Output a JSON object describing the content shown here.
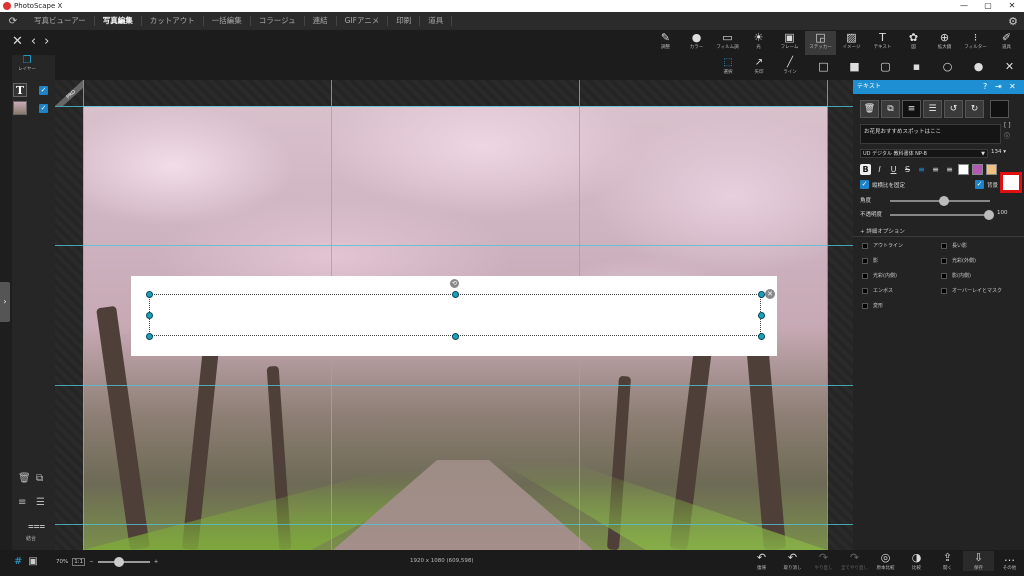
{
  "window": {
    "title": "PhotoScape X",
    "controls": [
      "—",
      "▢",
      "✕"
    ]
  },
  "menu": {
    "items": [
      "写真ビューアー",
      "写真編集",
      "カットアウト",
      "一括編集",
      "コラージュ",
      "連結",
      "GIFアニメ",
      "印刷",
      "道具"
    ],
    "active": "写真編集"
  },
  "nav": {
    "close": "✕",
    "back": "‹",
    "forward": "›"
  },
  "edit_tools": [
    {
      "icon": "✎",
      "label": "調整"
    },
    {
      "icon": "●",
      "label": "カラー"
    },
    {
      "icon": "▭",
      "label": "フィルム調"
    },
    {
      "icon": "☀",
      "label": "光"
    },
    {
      "icon": "▣",
      "label": "フレーム"
    },
    {
      "icon": "◲",
      "label": "ステッカー"
    },
    {
      "icon": "▨",
      "label": "イメージ"
    },
    {
      "icon": "T",
      "label": "テキスト"
    },
    {
      "icon": "✿",
      "label": "図"
    },
    {
      "icon": "⊕",
      "label": "拡大鏡"
    },
    {
      "icon": "⁝",
      "label": "フィルター"
    },
    {
      "icon": "✐",
      "label": "道具"
    }
  ],
  "insert_tools": [
    {
      "icon": "⬚",
      "label": "選択"
    },
    {
      "icon": "↗",
      "label": "矢印"
    },
    {
      "icon": "╱",
      "label": "ライン"
    }
  ],
  "shape_tools": [
    "□",
    "■",
    "▢",
    "▪",
    "○",
    "●",
    "✕"
  ],
  "layers": {
    "label": "レイヤー",
    "combine_label": "結合",
    "badge": "PRO"
  },
  "text_panel": {
    "title": "テキスト",
    "text_value": "お花見おすすめスポットはここ",
    "font": "UD デジタル 教科書体 NP-B",
    "font_size": "134",
    "keep_ratio": "縦横比を固定",
    "bg_label": "背景",
    "angle_label": "角度",
    "angle_value": "0",
    "opacity_label": "不透明度",
    "opacity_value": "100",
    "detail_options": "詳細オプション",
    "options": [
      "アウトライン",
      "長い影",
      "影",
      "光彩(外側)",
      "光彩(内側)",
      "影(内側)",
      "エンボス",
      "オーバーレイとマスク",
      "変形"
    ],
    "accent_color": "#1d8fd2",
    "highlight_color": "#e01010"
  },
  "status": {
    "zoom": "70%",
    "ratio": "1:1",
    "image_info": "1920 x 1080 (609,598)"
  },
  "bottom_tools": [
    {
      "icon": "↶",
      "label": "復帰",
      "enabled": true
    },
    {
      "icon": "↶",
      "label": "取り消し",
      "enabled": true
    },
    {
      "icon": "↷",
      "label": "やり直し",
      "enabled": false
    },
    {
      "icon": "↷",
      "label": "全てやり直し",
      "enabled": false
    },
    {
      "icon": "◎",
      "label": "原本比較",
      "enabled": true
    },
    {
      "icon": "◑",
      "label": "比較",
      "enabled": true
    },
    {
      "icon": "⇪",
      "label": "開く",
      "enabled": true
    },
    {
      "icon": "⇩",
      "label": "保存",
      "enabled": true
    },
    {
      "icon": "…",
      "label": "その他",
      "enabled": true
    }
  ]
}
